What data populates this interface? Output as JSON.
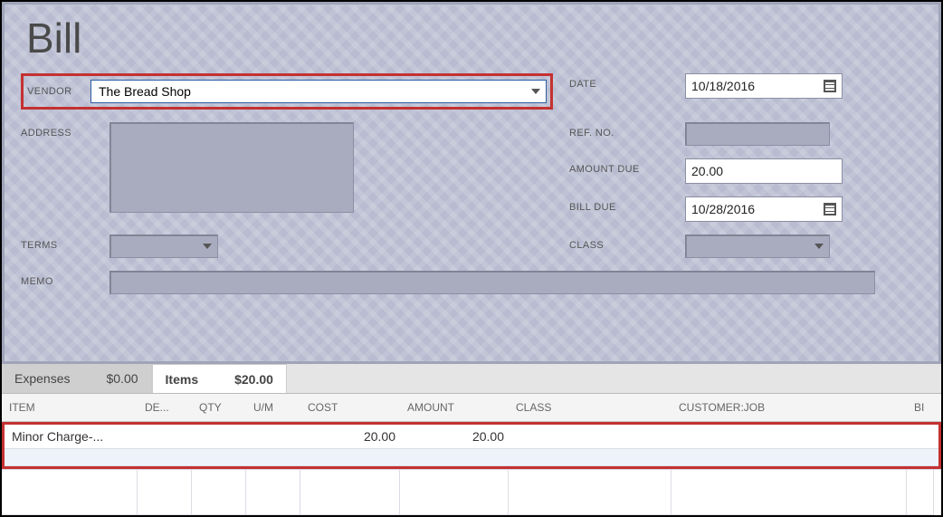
{
  "title": "Bill",
  "labels": {
    "vendor": "VENDOR",
    "address": "ADDRESS",
    "terms": "TERMS",
    "memo": "MEMO",
    "date": "DATE",
    "ref_no": "REF. NO.",
    "amount_due": "AMOUNT DUE",
    "bill_due": "BILL DUE",
    "class": "CLASS"
  },
  "fields": {
    "vendor": "The Bread Shop",
    "address": "",
    "terms": "",
    "memo": "",
    "date": "10/18/2016",
    "ref_no": "",
    "amount_due": "20.00",
    "bill_due": "10/28/2016",
    "class": ""
  },
  "tabs": {
    "expenses": {
      "label": "Expenses",
      "amount": "$0.00"
    },
    "items": {
      "label": "Items",
      "amount": "$20.00"
    }
  },
  "columns": {
    "item": "ITEM",
    "desc": "DE...",
    "qty": "QTY",
    "um": "U/M",
    "cost": "COST",
    "amount": "AMOUNT",
    "class": "CLASS",
    "customer_job": "CUSTOMER:JOB",
    "bill": "BI"
  },
  "rows": [
    {
      "item": "Minor Charge-...",
      "desc": "",
      "qty": "",
      "um": "",
      "cost": "20.00",
      "amount": "20.00",
      "class": "",
      "customer_job": ""
    }
  ]
}
